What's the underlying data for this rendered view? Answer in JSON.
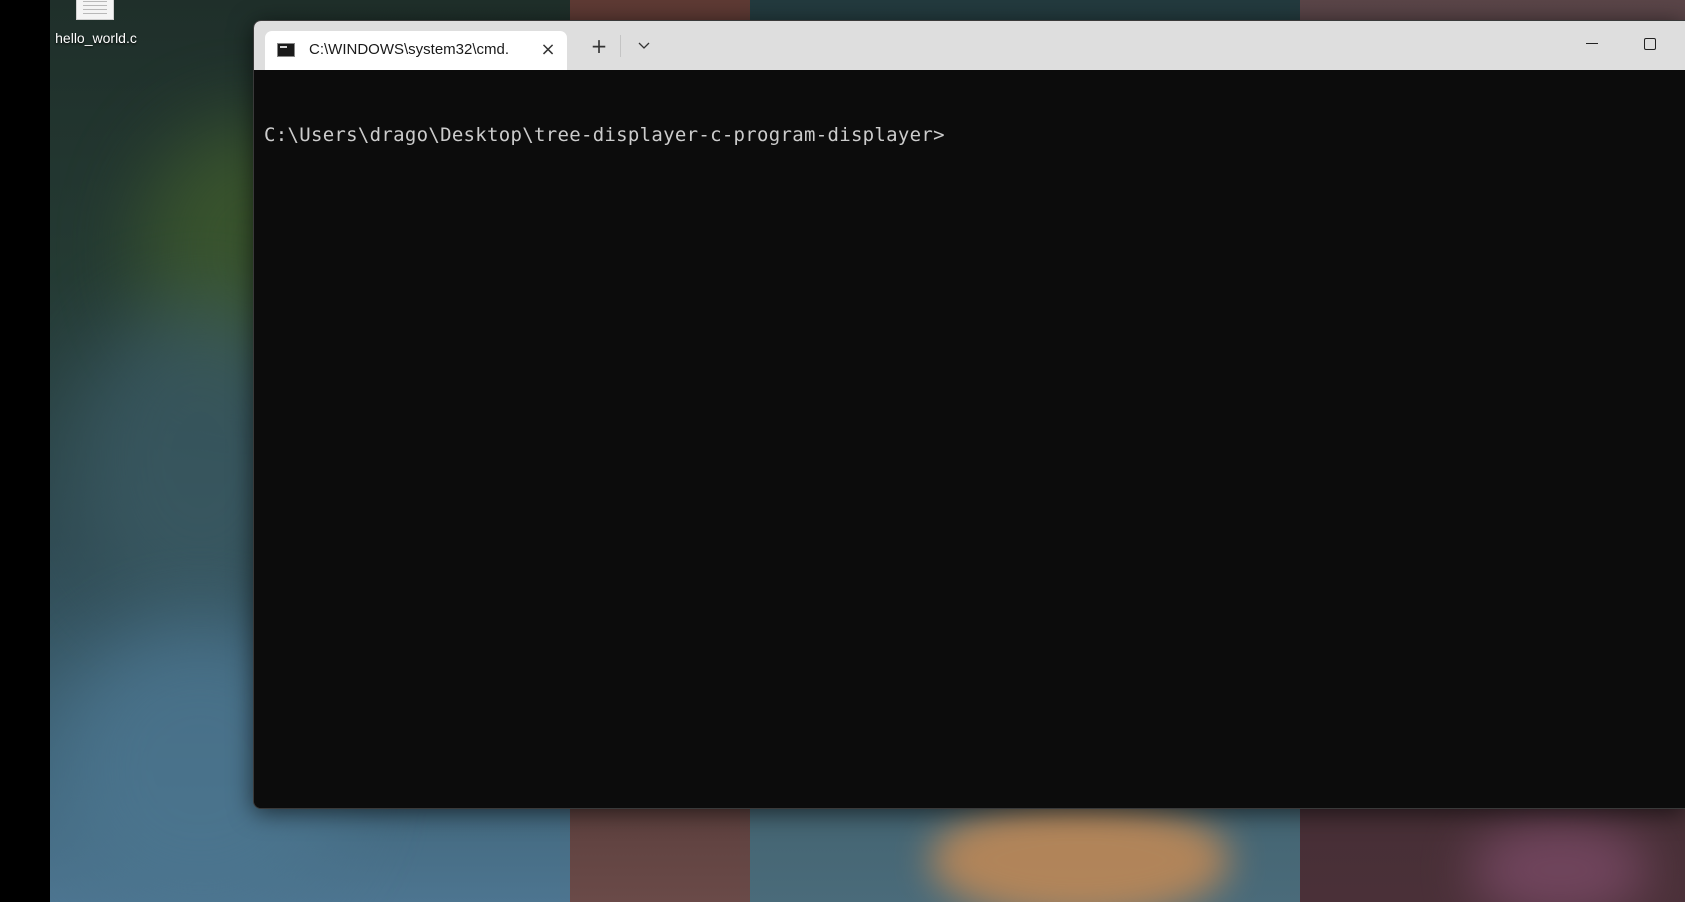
{
  "desktop": {
    "icons": [
      {
        "label": "hello_world.c",
        "icon": "c-source-file-icon"
      }
    ]
  },
  "terminal": {
    "tab": {
      "title": "C:\\WINDOWS\\system32\\cmd.",
      "icon": "cmd-icon",
      "close_icon": "close-icon"
    },
    "new_tab_icon": "plus-icon",
    "dropdown_icon": "chevron-down-icon",
    "window_controls": [
      "minimize",
      "maximize"
    ],
    "console": {
      "lines": [
        "C:\\Users\\drago\\Desktop\\tree-displayer-c-program-displayer>"
      ]
    }
  },
  "colors": {
    "console_bg": "#0c0c0c",
    "console_fg": "#cccccc",
    "titlebar_bg": "#dedede",
    "active_tab_bg": "#ffffff"
  }
}
